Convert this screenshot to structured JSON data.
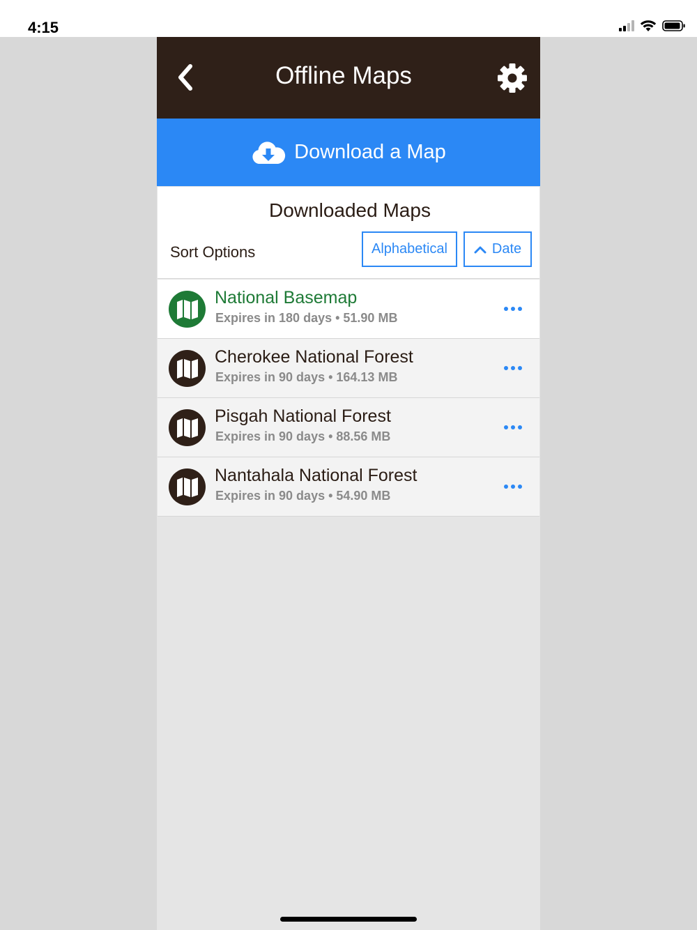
{
  "status_bar": {
    "time": "4:15",
    "icons": [
      "cellular-signal-icon",
      "wifi-icon",
      "battery-icon"
    ]
  },
  "nav": {
    "title": "Offline Maps",
    "back_icon": "chevron-left-icon",
    "settings_icon": "gear-icon"
  },
  "download_button": {
    "label": "Download a Map",
    "icon": "cloud-download-icon"
  },
  "downloaded": {
    "heading": "Downloaded Maps",
    "sort_label": "Sort Options",
    "sort_buttons": {
      "alphabetical": "Alphabetical",
      "date": "Date",
      "date_icon": "chevron-up-icon"
    }
  },
  "maps": [
    {
      "name": "National Basemap",
      "meta": "Expires in 180 days • 51.90 MB"
    },
    {
      "name": "Cherokee National Forest",
      "meta": "Expires in 90 days • 164.13 MB"
    },
    {
      "name": "Pisgah National Forest",
      "meta": "Expires in 90 days • 88.56 MB"
    },
    {
      "name": "Nantahala National Forest",
      "meta": "Expires in 90 days • 54.90 MB"
    }
  ],
  "colors": {
    "nav_bg": "#2f2018",
    "accent_blue": "#2b88f5",
    "basemap_green": "#1e7a36"
  }
}
